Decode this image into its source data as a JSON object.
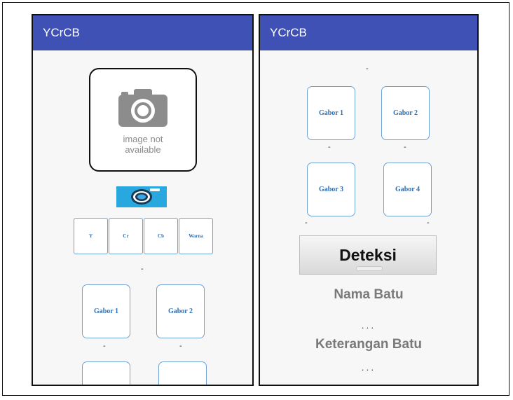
{
  "left_screen": {
    "title": "YCrCB",
    "image_placeholder": {
      "line1": "image not",
      "line2": "available"
    },
    "camera_button_icon": "camera-icon",
    "channels": [
      "Y",
      "Cr",
      "Cb",
      "Warna"
    ],
    "channel_result": "-",
    "gabor_cards": [
      "Gabor 1",
      "Gabor 2"
    ],
    "gabor_results": [
      "-",
      "-"
    ]
  },
  "right_screen": {
    "title": "YCrCB",
    "top_result": "-",
    "gabor_cards": [
      "Gabor 1",
      "Gabor 2",
      "Gabor 3",
      "Gabor 4"
    ],
    "gabor_results": [
      "-",
      "-",
      "-",
      "-"
    ],
    "detect_button": "Deteksi",
    "stone_name_label": "Nama Batu",
    "stone_name_value": "...",
    "stone_desc_label": "Keterangan Batu",
    "stone_desc_value": "..."
  },
  "colors": {
    "appbar": "#3f51b5",
    "card_text": "#2f6eb0",
    "camera_button": "#29a8e0"
  }
}
